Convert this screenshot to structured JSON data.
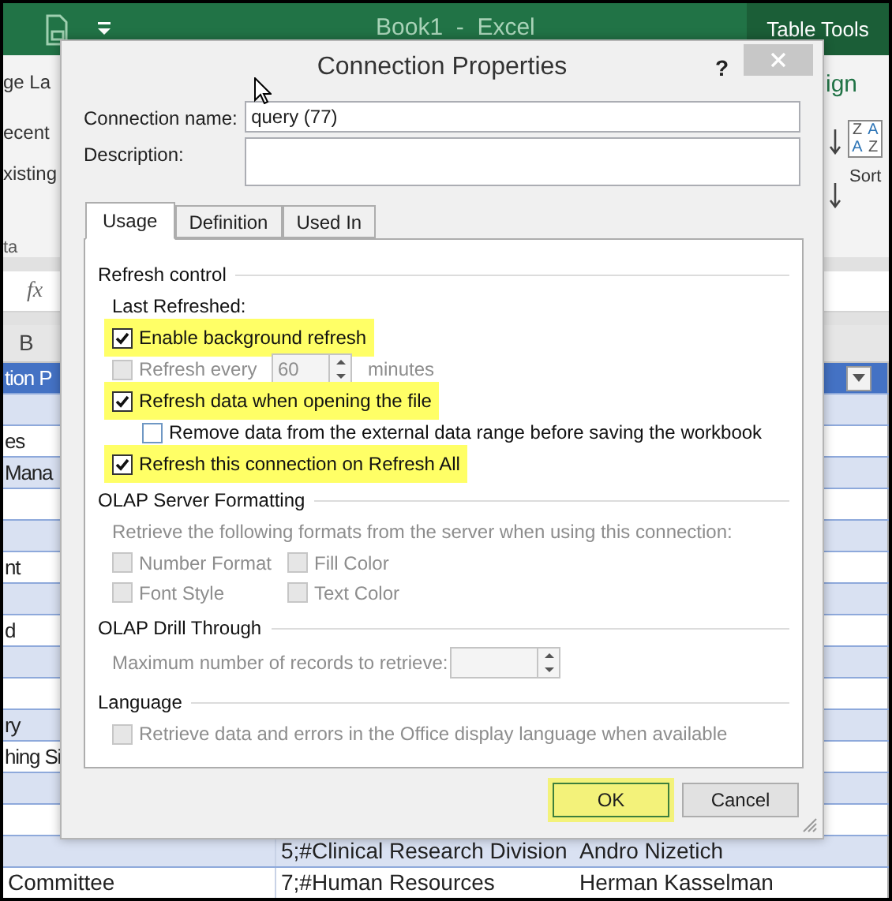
{
  "excel": {
    "title": "Book1  -  Excel",
    "contextual_tab": "Table Tools",
    "ribbon_left": [
      "ge La",
      "ecent",
      "xisting",
      "ta"
    ],
    "ribbon_right": {
      "tab_fragment": "ign",
      "sort_letters": [
        "Z",
        "A",
        "A",
        "Z"
      ],
      "sort_label": "Sort"
    },
    "formula_bar": {
      "fx": "fx"
    },
    "column_header": "B",
    "table": {
      "header": {
        "column_1": "tion P"
      },
      "rows": [
        {},
        {
          "column_1": "es"
        },
        {
          "column_1": "Mana"
        },
        {},
        {},
        {
          "column_1": "nt"
        },
        {},
        {
          "column_1": "d"
        },
        {},
        {},
        {
          "column_1": "ry"
        },
        {
          "column_1": "hing Si"
        },
        {},
        {},
        {
          "column_2": "5;#Clinical Research Division",
          "column_3": "Andro Nizetich"
        },
        {
          "column_1": "Committee",
          "column_2": "7;#Human Resources",
          "column_3": "Herman Kasselman"
        }
      ]
    }
  },
  "dialog": {
    "title": "Connection Properties",
    "help": "?",
    "fields": [
      {
        "kind": "line",
        "label": "Connection name:",
        "value": "query (77)"
      },
      {
        "kind": "area",
        "label": "Description:"
      }
    ],
    "tabs": [
      {
        "label": "Usage",
        "selected": true
      },
      {
        "label": "Definition",
        "selected": false
      },
      {
        "label": "Used In",
        "selected": false
      }
    ],
    "sections": [
      {
        "title": "Refresh control",
        "items": [
          {
            "kind": "text",
            "text": "Last Refreshed:",
            "disabled": false
          },
          {
            "kind": "checkbox",
            "label": "Enable background refresh",
            "checked": true,
            "disabled": false,
            "highlighted": true
          },
          {
            "kind": "interval",
            "label": "Refresh every",
            "checked": false,
            "disabled": true,
            "value": "60",
            "unit": "minutes"
          },
          {
            "kind": "checkbox",
            "label": "Refresh data when opening the file",
            "checked": true,
            "disabled": false,
            "highlighted": true,
            "children": [
              {
                "kind": "checkbox",
                "label": "Remove data from the external data range before saving the workbook",
                "checked": false,
                "disabled": false,
                "highlighted": false
              }
            ]
          },
          {
            "kind": "checkbox",
            "label": "Refresh this connection on Refresh All",
            "checked": true,
            "disabled": false,
            "highlighted": true
          }
        ]
      },
      {
        "title": "OLAP Server Formatting",
        "items": [
          {
            "kind": "text",
            "text": "Retrieve the following formats from the server when using this connection:",
            "disabled": true
          },
          {
            "kind": "checkbox_grid",
            "items": [
              {
                "kind": "checkbox",
                "label": "Number Format",
                "checked": false,
                "disabled": true,
                "highlighted": false
              },
              {
                "kind": "checkbox",
                "label": "Fill Color",
                "checked": false,
                "disabled": true,
                "highlighted": false
              },
              {
                "kind": "checkbox",
                "label": "Font Style",
                "checked": false,
                "disabled": true,
                "highlighted": false
              },
              {
                "kind": "checkbox",
                "label": "Text Color",
                "checked": false,
                "disabled": true,
                "highlighted": false
              }
            ]
          }
        ]
      },
      {
        "title": "OLAP Drill Through",
        "items": [
          {
            "kind": "number",
            "label": "Maximum number of records to retrieve:",
            "disabled": true
          }
        ]
      },
      {
        "title": "Language",
        "items": [
          {
            "kind": "checkbox",
            "label": "Retrieve data and errors in the Office display language when available",
            "checked": false,
            "disabled": true,
            "highlighted": false
          }
        ]
      }
    ],
    "buttons": [
      {
        "label": "OK",
        "highlighted": true
      },
      {
        "label": "Cancel",
        "highlighted": false
      }
    ]
  }
}
